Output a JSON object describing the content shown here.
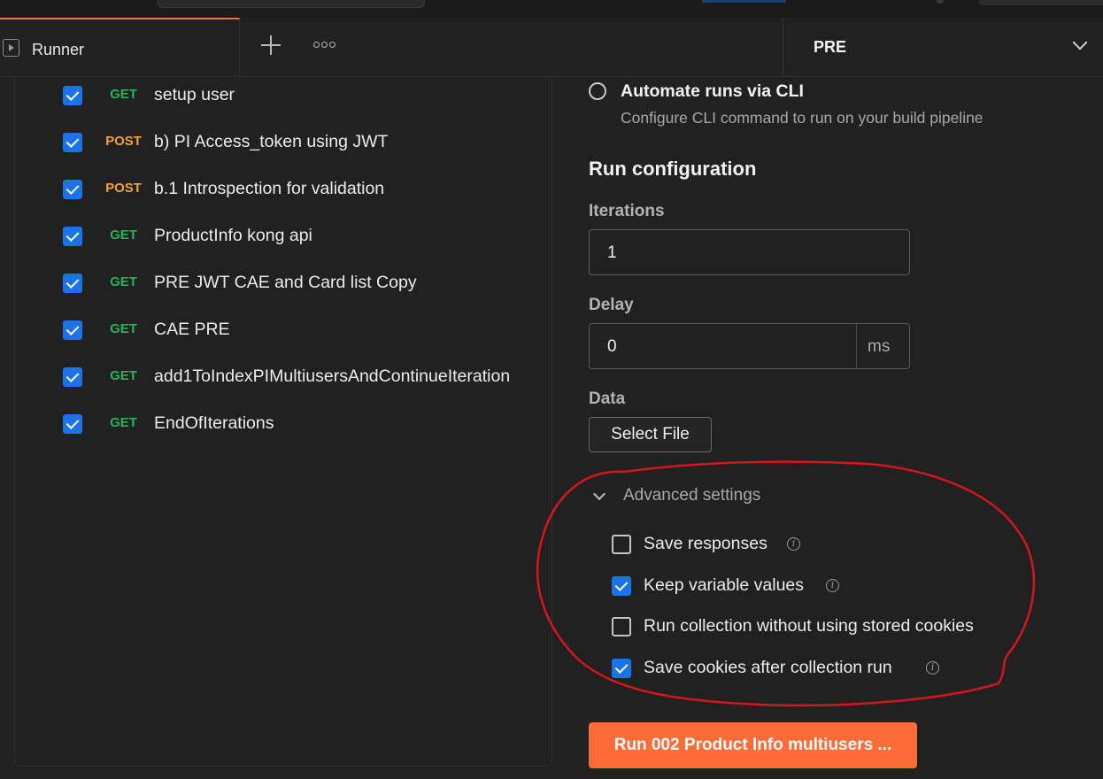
{
  "tab": {
    "label": "Runner"
  },
  "environment": {
    "label": "PRE"
  },
  "requests": [
    {
      "method": "GET",
      "name": "setup user",
      "checked": true
    },
    {
      "method": "POST",
      "name": "b) PI Access_token using JWT",
      "checked": true
    },
    {
      "method": "POST",
      "name": "b.1 Introspection for validation",
      "checked": true
    },
    {
      "method": "GET",
      "name": "ProductInfo kong api",
      "checked": true
    },
    {
      "method": "GET",
      "name": "PRE JWT CAE and Card list Copy",
      "checked": true
    },
    {
      "method": "GET",
      "name": "CAE PRE",
      "checked": true
    },
    {
      "method": "GET",
      "name": "add1ToIndexPIMultiusersAndContinueIteration",
      "checked": true
    },
    {
      "method": "GET",
      "name": "EndOfIterations",
      "checked": true
    }
  ],
  "cli": {
    "title": "Automate runs via CLI",
    "subtitle": "Configure CLI command to run on your build pipeline"
  },
  "run_config": {
    "title": "Run configuration",
    "iterations_label": "Iterations",
    "iterations_value": "1",
    "delay_label": "Delay",
    "delay_value": "0",
    "delay_unit": "ms",
    "data_label": "Data",
    "select_file_label": "Select File"
  },
  "advanced": {
    "title": "Advanced settings",
    "options": [
      {
        "label": "Save responses",
        "checked": false,
        "info": true
      },
      {
        "label": "Keep variable values",
        "checked": true,
        "info": true
      },
      {
        "label": "Run collection without using stored cookies",
        "checked": false,
        "info": false
      },
      {
        "label": "Save cookies after collection run",
        "checked": true,
        "info": true
      }
    ]
  },
  "run_button": {
    "label": "Run 002 Product Info multiusers ..."
  },
  "colors": {
    "accent": "#ff6c37",
    "checkbox": "#1a73e8",
    "get": "#26b35a",
    "post": "#f2a233",
    "annotation": "#d4161e"
  }
}
